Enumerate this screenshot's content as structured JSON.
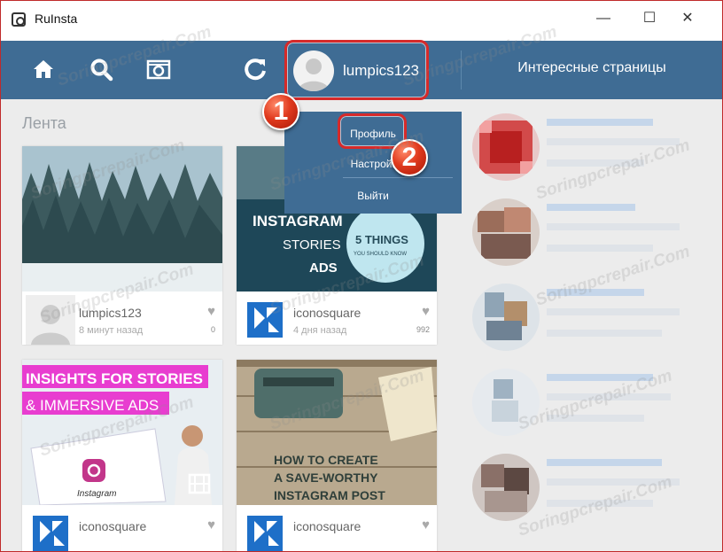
{
  "window": {
    "title": "RuInsta",
    "minimize": "—",
    "maximize": "☐",
    "close": "✕"
  },
  "toolbar": {
    "profile_name": "lumpics123",
    "interesting_label": "Интересные страницы"
  },
  "feed": {
    "title": "Лента",
    "posts": [
      {
        "user": "lumpics123",
        "time": "8 минут назад",
        "likes": "0",
        "image_text": []
      },
      {
        "user": "iconosquare",
        "time": "4 дня назад",
        "likes": "992",
        "image_text": [
          "INSTAGRAM",
          "STORIES",
          "ADS",
          "5 THINGS",
          "YOU SHOULD KNOW"
        ]
      },
      {
        "user": "iconosquare",
        "time": "",
        "likes": "",
        "image_text": [
          "INSIGHTS FOR STORIES",
          "& IMMERSIVE ADS",
          "Instagram"
        ]
      },
      {
        "user": "iconosquare",
        "time": "",
        "likes": "",
        "image_text": [
          "HOW TO CREATE",
          "A SAVE-WORTHY",
          "INSTAGRAM POST"
        ]
      }
    ]
  },
  "dropdown": {
    "profile": "Профиль",
    "settings": "Настройки",
    "logout": "Выйти"
  },
  "markers": [
    "1",
    "2"
  ],
  "watermark": "Soringpcrepair.Com",
  "colors": {
    "accent": "#3f6c94",
    "highlight": "#d62a2a"
  },
  "icons": [
    "home-icon",
    "search-icon",
    "camera-icon",
    "refresh-icon",
    "heart-icon",
    "film-icon"
  ]
}
